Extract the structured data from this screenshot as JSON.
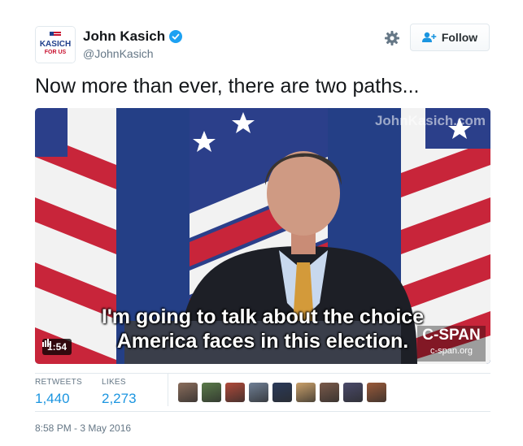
{
  "author": {
    "avatar_text_top": "KASICH",
    "avatar_text_bottom": "FOR US",
    "name": "John Kasich",
    "handle": "@JohnKasich",
    "verified_icon": "verified-badge-icon"
  },
  "actions": {
    "settings_icon": "gear-icon",
    "follow_label": "Follow",
    "follow_icon": "add-person-icon"
  },
  "tweet": {
    "text": "Now more than ever, there are two paths..."
  },
  "media": {
    "watermark": "JohnKasich.com",
    "caption_line1": "I'm going to talk about the choice",
    "caption_line2": "America faces in this election.",
    "duration": "1:54",
    "network_logo": "C-SPAN",
    "network_url": "c-span.org"
  },
  "stats": {
    "retweets_label": "RETWEETS",
    "retweets_value": "1,440",
    "likes_label": "LIKES",
    "likes_value": "2,273"
  },
  "likers": [
    "#8a6d5c",
    "#5a7a4a",
    "#b04a3a",
    "#6f7f95",
    "#2a3a5a",
    "#c9a06a",
    "#7a5a4a",
    "#4a4a6a",
    "#9a5a3a"
  ],
  "timestamp": "8:58 PM - 3 May 2016",
  "colors": {
    "link_blue": "#1b95e0",
    "muted": "#657786",
    "verified": "#1da1f2"
  }
}
